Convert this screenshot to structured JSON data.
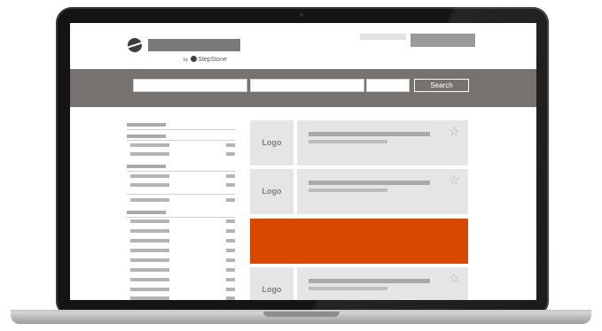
{
  "header": {
    "byline_prefix": "by",
    "byline_brand": "StepStone"
  },
  "search": {
    "button_label": "Search"
  },
  "results": [
    {
      "logo_label": "Logo"
    },
    {
      "logo_label": "Logo"
    },
    {
      "featured": true,
      "color": "#d94801"
    },
    {
      "logo_label": "Logo"
    }
  ],
  "icons": {
    "brand": "stepstone-logo-icon",
    "favorite": "star-outline-icon"
  },
  "colors": {
    "accent": "#d94801",
    "search_strip": "#767270",
    "card_bg": "#e6e4e4"
  }
}
